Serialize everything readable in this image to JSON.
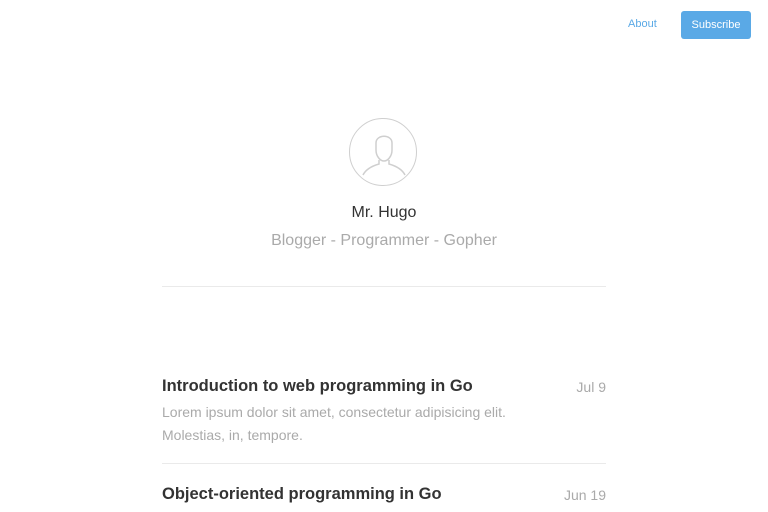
{
  "nav": {
    "about_label": "About",
    "subscribe_label": "Subscribe"
  },
  "profile": {
    "avatar_icon": "user-silhouette-icon",
    "name": "Mr. Hugo",
    "tagline": "Blogger - Programmer - Gopher"
  },
  "posts": [
    {
      "title": "Introduction to web programming in Go",
      "date": "Jul 9",
      "excerpt": "Lorem ipsum dolor sit amet, consectetur adipisicing elit. Molestias, in, tempore."
    },
    {
      "title": "Object-oriented programming in Go",
      "date": "Jun 19"
    }
  ],
  "colors": {
    "accent": "#5aa9e6",
    "text_primary": "#333333",
    "text_muted": "#aaaaaa",
    "divider": "#eaeaea"
  }
}
